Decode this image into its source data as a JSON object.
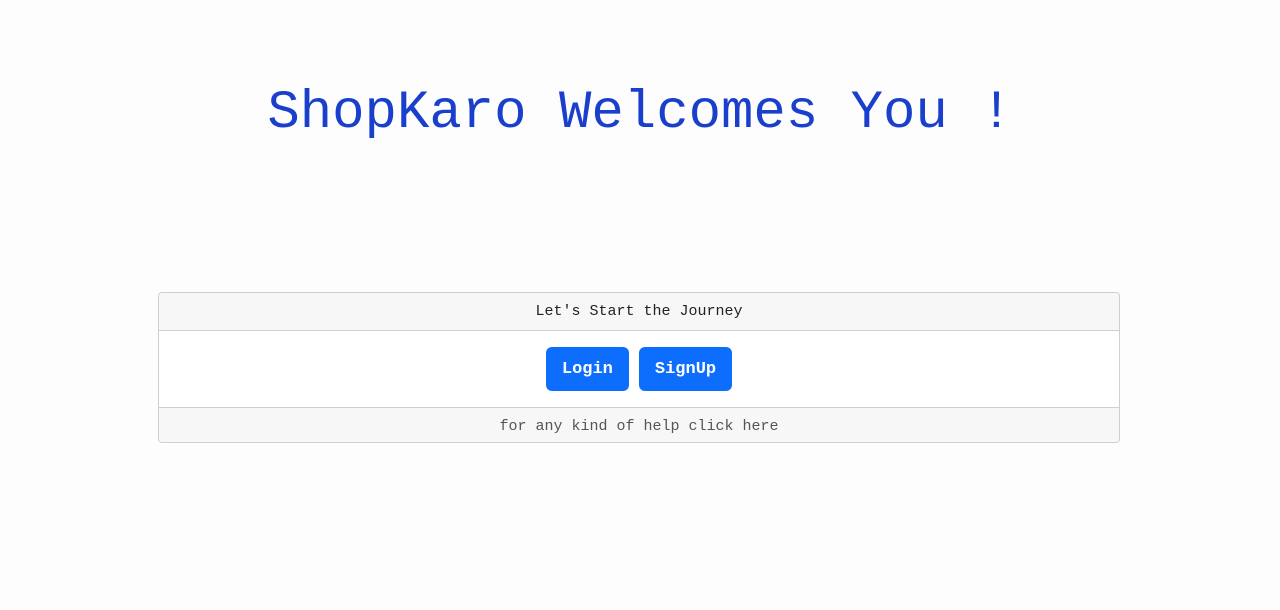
{
  "header": {
    "title": "ShopKaro Welcomes You !"
  },
  "card": {
    "header_text": "Let's Start the Journey",
    "login_label": "Login",
    "signup_label": "SignUp",
    "footer_text": "for any kind of help click here"
  },
  "colors": {
    "title": "#1a3fcc",
    "button": "#0d6efd",
    "page_background": "#fdfdfd"
  }
}
